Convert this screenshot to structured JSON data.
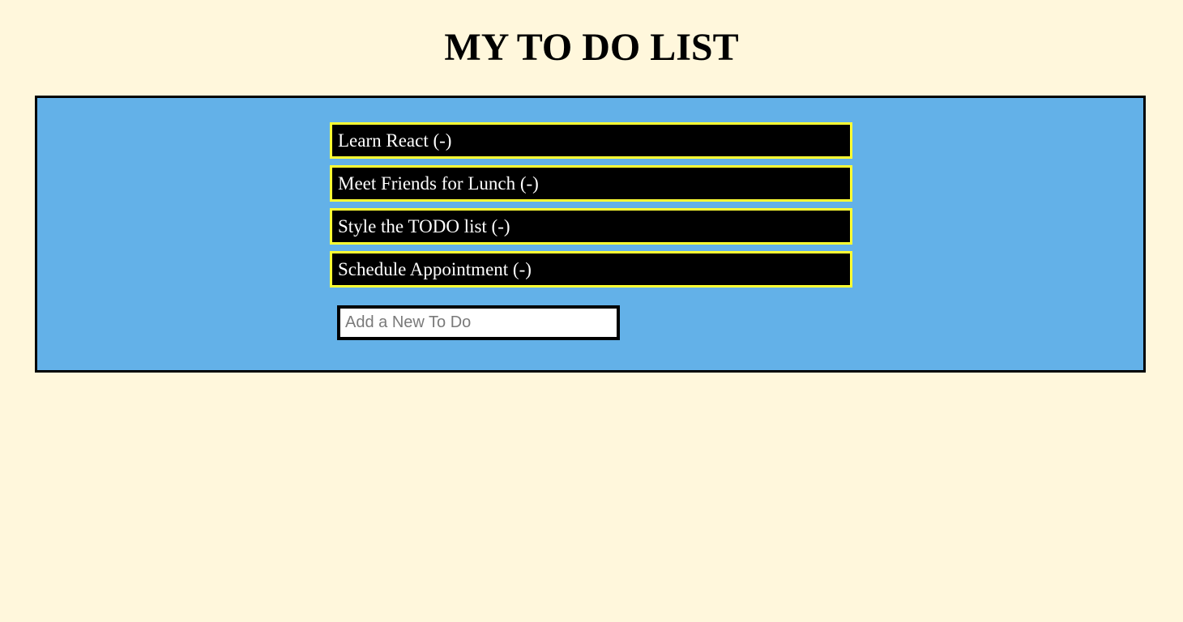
{
  "page": {
    "title": "MY TO DO LIST"
  },
  "todos": {
    "items": [
      {
        "label": "Learn React (-)"
      },
      {
        "label": "Meet Friends for Lunch (-)"
      },
      {
        "label": "Style the TODO list (-)"
      },
      {
        "label": "Schedule Appointment (-)"
      }
    ]
  },
  "new_todo": {
    "placeholder": "Add a New To Do",
    "value": ""
  },
  "colors": {
    "background": "#fff7dc",
    "panel": "#63b1e8",
    "item_background": "#000000",
    "item_border": "#ffff33",
    "item_text": "#ffffff"
  }
}
